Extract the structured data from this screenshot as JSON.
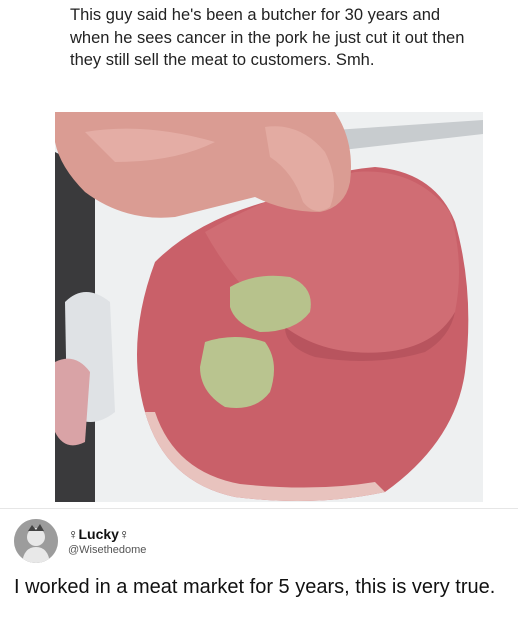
{
  "post": {
    "caption": "This guy said he's been a butcher for 30 years and when he sees cancer in the pork he just cut it out then they still sell the meat to customers. Smh."
  },
  "photo": {
    "subject": "meat-photo"
  },
  "tweet": {
    "display_name": "♀Lucky♀",
    "handle": "@Wisethedome",
    "text": "I worked in a meat market for 5 years, this is very true."
  },
  "colors": {
    "meat": "#c9606a",
    "meat_dark": "#a94b55",
    "fat": "#e9c2bd",
    "lesion": "#b9c48d",
    "glove": "#d99a91",
    "board": "#f2f3f4"
  }
}
